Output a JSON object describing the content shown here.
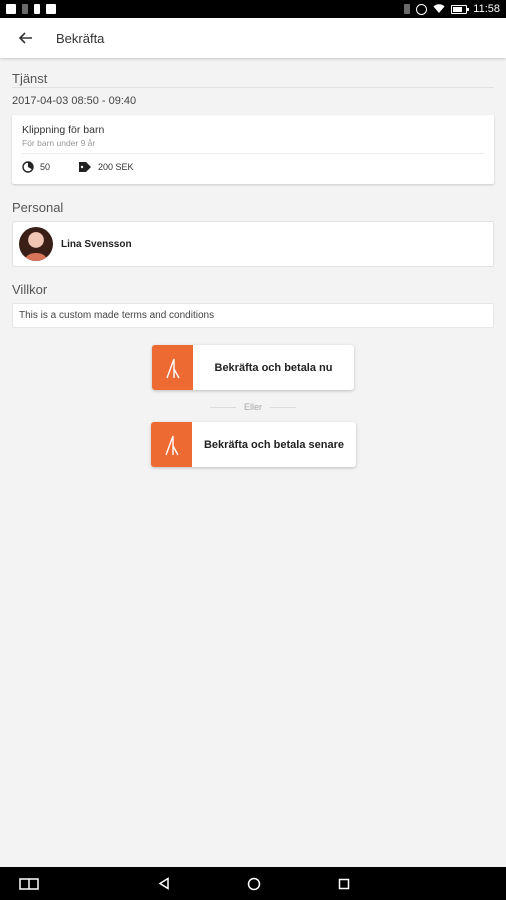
{
  "status_bar": {
    "time": "11:58",
    "icons": [
      "gallery-icon",
      "bluetooth-icon",
      "sd-card-icon",
      "photo-icon",
      "vibrate-icon",
      "alarm-icon",
      "wifi-icon",
      "battery-icon"
    ],
    "battery_level": 0.7
  },
  "header": {
    "back_icon": "arrow-left-icon",
    "title": "Bekräfta"
  },
  "service": {
    "section_label": "Tjänst",
    "datetime": "2017-04-03 08:50 - 09:40",
    "name": "Klippning för barn",
    "description": "För barn under 9 år",
    "duration": "50",
    "price": "200 SEK"
  },
  "staff": {
    "section_label": "Personal",
    "name": "Lina Svensson"
  },
  "terms": {
    "section_label": "Villkor",
    "text": "This is a custom made terms and conditions"
  },
  "actions": {
    "pay_now": "Bekräfta och betala nu",
    "separator": "Eller",
    "pay_later": "Bekräfta och betala senare"
  },
  "colors": {
    "accent": "#ee6a33",
    "background": "#f3f3f3",
    "status_bar": "#000000"
  },
  "nav_bar": {
    "icons": [
      "split-screen-icon",
      "back-triangle-icon",
      "home-circle-icon",
      "recents-square-icon"
    ]
  }
}
